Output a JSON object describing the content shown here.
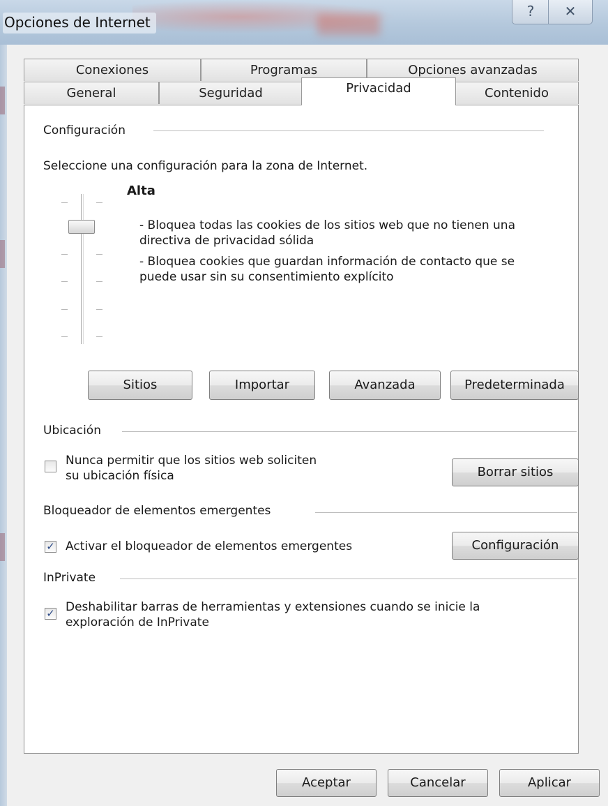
{
  "window": {
    "title": "Opciones de Internet",
    "help_glyph": "?",
    "close_glyph": "✕"
  },
  "tabs": {
    "row1": [
      "Conexiones",
      "Programas",
      "Opciones avanzadas"
    ],
    "row2": [
      "General",
      "Seguridad",
      "Privacidad",
      "Contenido"
    ],
    "active": "Privacidad"
  },
  "configuracion": {
    "group_label": "Configuración",
    "intro": "Seleccione una configuración para la zona de Internet.",
    "level_name": "Alta",
    "slider_level": 5,
    "slider_levels": 6,
    "desc_line1": "- Bloquea todas las cookies de los sitios web que no tienen una",
    "desc_line2": "directiva de privacidad sólida",
    "desc_line3": "- Bloquea cookies que guardan información de contacto que se",
    "desc_line4": "puede usar sin su consentimiento explícito",
    "buttons": [
      "Sitios",
      "Importar",
      "Avanzada",
      "Predeterminada"
    ]
  },
  "ubicacion": {
    "group_label": "Ubicación",
    "checkbox_line1": "Nunca permitir que los sitios web soliciten",
    "checkbox_line2": "su ubicación física",
    "checked": false,
    "button": "Borrar sitios"
  },
  "bloqueador": {
    "group_label": "Bloqueador de elementos emergentes",
    "checkbox_label": "Activar el bloqueador de elementos emergentes",
    "checked": true,
    "button": "Configuración"
  },
  "inprivate": {
    "group_label": "InPrivate",
    "checkbox_line1": "Deshabilitar barras de herramientas y extensiones cuando se inicie la",
    "checkbox_line2": "exploración de InPrivate",
    "checked": true
  },
  "footer": {
    "ok": "Aceptar",
    "cancel": "Cancelar",
    "apply": "Aplicar"
  },
  "check_glyph": "✓"
}
